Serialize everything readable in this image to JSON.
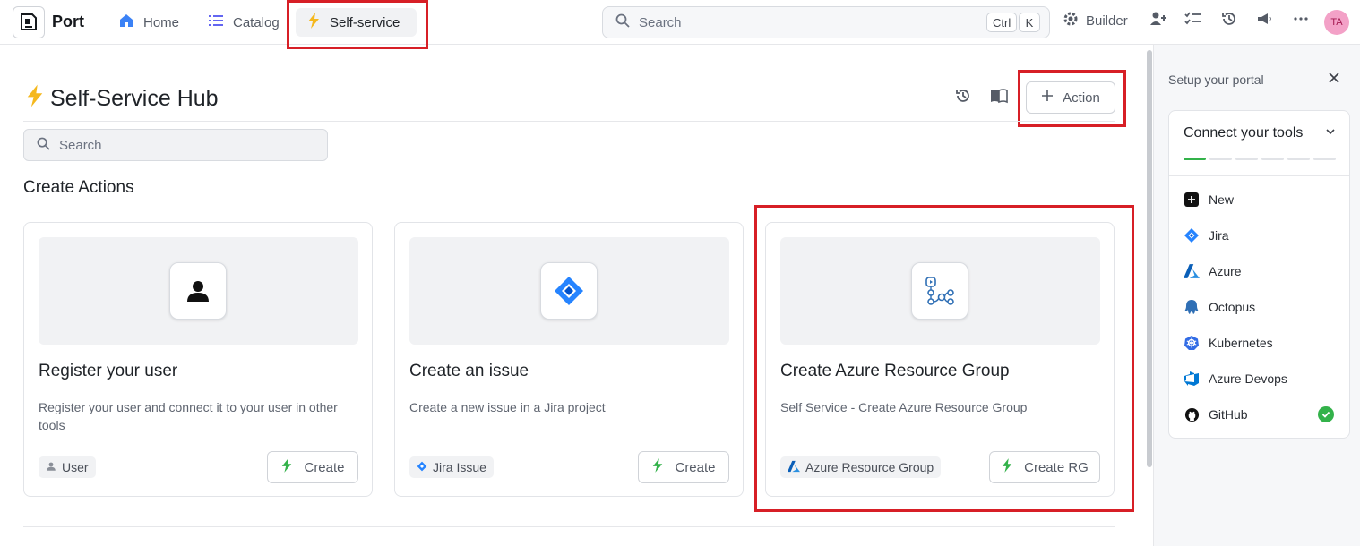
{
  "topbar": {
    "logo_text": "Port",
    "nav": [
      {
        "label": "Home",
        "icon": "home-icon"
      },
      {
        "label": "Catalog",
        "icon": "catalog-list-icon"
      },
      {
        "label": "Self-service",
        "icon": "lightning-icon"
      }
    ],
    "search_placeholder": "Search",
    "shortcut_keys": [
      "Ctrl",
      "K"
    ],
    "builder_label": "Builder",
    "avatar_initials": "TA"
  },
  "main": {
    "title": "Self-Service Hub",
    "action_button": "Action",
    "search_placeholder": "Search",
    "section_title": "Create Actions",
    "cards": [
      {
        "title": "Register your user",
        "description": "Register your user and connect it to your user in other tools",
        "tag": "User",
        "button": "Create",
        "icon": "user-icon"
      },
      {
        "title": "Create an issue",
        "description": "Create a new issue in a Jira project",
        "tag": "Jira Issue",
        "button": "Create",
        "icon": "jira-icon"
      },
      {
        "title": "Create Azure Resource Group",
        "description": "Self Service - Create Azure Resource Group",
        "tag": "Azure Resource Group",
        "button": "Create RG",
        "icon": "workflow-icon"
      }
    ]
  },
  "panel": {
    "title": "Setup your portal",
    "card_title": "Connect your tools",
    "progress_done": 1,
    "progress_total": 6,
    "tools": [
      {
        "label": "New",
        "icon": "plus-square-icon"
      },
      {
        "label": "Jira",
        "icon": "jira-icon"
      },
      {
        "label": "Azure",
        "icon": "azure-icon"
      },
      {
        "label": "Octopus",
        "icon": "octopus-icon"
      },
      {
        "label": "Kubernetes",
        "icon": "kubernetes-icon"
      },
      {
        "label": "Azure Devops",
        "icon": "azure-devops-icon"
      },
      {
        "label": "GitHub",
        "icon": "github-icon",
        "connected": true
      }
    ]
  },
  "colors": {
    "accent_yellow": "#f5b81d",
    "highlight_red": "#d71f26",
    "success_green": "#33b24a",
    "jira_blue": "#2684ff"
  }
}
